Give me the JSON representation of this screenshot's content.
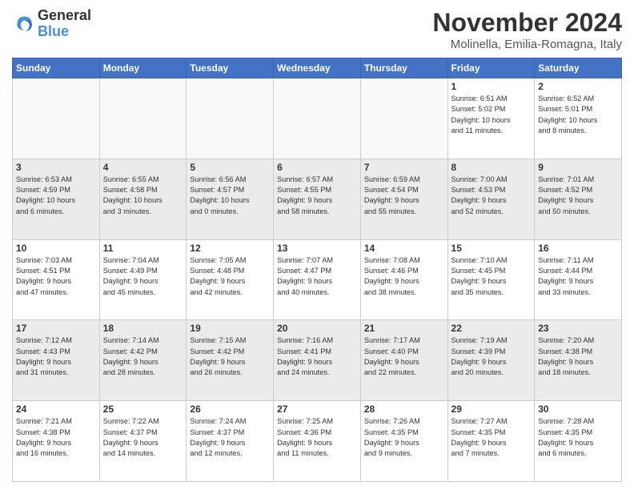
{
  "logo": {
    "line1": "General",
    "line2": "Blue"
  },
  "title": "November 2024",
  "location": "Molinella, Emilia-Romagna, Italy",
  "days_of_week": [
    "Sunday",
    "Monday",
    "Tuesday",
    "Wednesday",
    "Thursday",
    "Friday",
    "Saturday"
  ],
  "weeks": [
    [
      {
        "day": "",
        "info": "",
        "empty": true
      },
      {
        "day": "",
        "info": "",
        "empty": true
      },
      {
        "day": "",
        "info": "",
        "empty": true
      },
      {
        "day": "",
        "info": "",
        "empty": true
      },
      {
        "day": "",
        "info": "",
        "empty": true
      },
      {
        "day": "1",
        "info": "Sunrise: 6:51 AM\nSunset: 5:02 PM\nDaylight: 10 hours\nand 11 minutes."
      },
      {
        "day": "2",
        "info": "Sunrise: 6:52 AM\nSunset: 5:01 PM\nDaylight: 10 hours\nand 8 minutes."
      }
    ],
    [
      {
        "day": "3",
        "info": "Sunrise: 6:53 AM\nSunset: 4:59 PM\nDaylight: 10 hours\nand 6 minutes."
      },
      {
        "day": "4",
        "info": "Sunrise: 6:55 AM\nSunset: 4:58 PM\nDaylight: 10 hours\nand 3 minutes."
      },
      {
        "day": "5",
        "info": "Sunrise: 6:56 AM\nSunset: 4:57 PM\nDaylight: 10 hours\nand 0 minutes."
      },
      {
        "day": "6",
        "info": "Sunrise: 6:57 AM\nSunset: 4:55 PM\nDaylight: 9 hours\nand 58 minutes."
      },
      {
        "day": "7",
        "info": "Sunrise: 6:59 AM\nSunset: 4:54 PM\nDaylight: 9 hours\nand 55 minutes."
      },
      {
        "day": "8",
        "info": "Sunrise: 7:00 AM\nSunset: 4:53 PM\nDaylight: 9 hours\nand 52 minutes."
      },
      {
        "day": "9",
        "info": "Sunrise: 7:01 AM\nSunset: 4:52 PM\nDaylight: 9 hours\nand 50 minutes."
      }
    ],
    [
      {
        "day": "10",
        "info": "Sunrise: 7:03 AM\nSunset: 4:51 PM\nDaylight: 9 hours\nand 47 minutes."
      },
      {
        "day": "11",
        "info": "Sunrise: 7:04 AM\nSunset: 4:49 PM\nDaylight: 9 hours\nand 45 minutes."
      },
      {
        "day": "12",
        "info": "Sunrise: 7:05 AM\nSunset: 4:48 PM\nDaylight: 9 hours\nand 42 minutes."
      },
      {
        "day": "13",
        "info": "Sunrise: 7:07 AM\nSunset: 4:47 PM\nDaylight: 9 hours\nand 40 minutes."
      },
      {
        "day": "14",
        "info": "Sunrise: 7:08 AM\nSunset: 4:46 PM\nDaylight: 9 hours\nand 38 minutes."
      },
      {
        "day": "15",
        "info": "Sunrise: 7:10 AM\nSunset: 4:45 PM\nDaylight: 9 hours\nand 35 minutes."
      },
      {
        "day": "16",
        "info": "Sunrise: 7:11 AM\nSunset: 4:44 PM\nDaylight: 9 hours\nand 33 minutes."
      }
    ],
    [
      {
        "day": "17",
        "info": "Sunrise: 7:12 AM\nSunset: 4:43 PM\nDaylight: 9 hours\nand 31 minutes."
      },
      {
        "day": "18",
        "info": "Sunrise: 7:14 AM\nSunset: 4:42 PM\nDaylight: 9 hours\nand 28 minutes."
      },
      {
        "day": "19",
        "info": "Sunrise: 7:15 AM\nSunset: 4:42 PM\nDaylight: 9 hours\nand 26 minutes."
      },
      {
        "day": "20",
        "info": "Sunrise: 7:16 AM\nSunset: 4:41 PM\nDaylight: 9 hours\nand 24 minutes."
      },
      {
        "day": "21",
        "info": "Sunrise: 7:17 AM\nSunset: 4:40 PM\nDaylight: 9 hours\nand 22 minutes."
      },
      {
        "day": "22",
        "info": "Sunrise: 7:19 AM\nSunset: 4:39 PM\nDaylight: 9 hours\nand 20 minutes."
      },
      {
        "day": "23",
        "info": "Sunrise: 7:20 AM\nSunset: 4:38 PM\nDaylight: 9 hours\nand 18 minutes."
      }
    ],
    [
      {
        "day": "24",
        "info": "Sunrise: 7:21 AM\nSunset: 4:38 PM\nDaylight: 9 hours\nand 16 minutes."
      },
      {
        "day": "25",
        "info": "Sunrise: 7:22 AM\nSunset: 4:37 PM\nDaylight: 9 hours\nand 14 minutes."
      },
      {
        "day": "26",
        "info": "Sunrise: 7:24 AM\nSunset: 4:37 PM\nDaylight: 9 hours\nand 12 minutes."
      },
      {
        "day": "27",
        "info": "Sunrise: 7:25 AM\nSunset: 4:36 PM\nDaylight: 9 hours\nand 11 minutes."
      },
      {
        "day": "28",
        "info": "Sunrise: 7:26 AM\nSunset: 4:35 PM\nDaylight: 9 hours\nand 9 minutes."
      },
      {
        "day": "29",
        "info": "Sunrise: 7:27 AM\nSunset: 4:35 PM\nDaylight: 9 hours\nand 7 minutes."
      },
      {
        "day": "30",
        "info": "Sunrise: 7:28 AM\nSunset: 4:35 PM\nDaylight: 9 hours\nand 6 minutes."
      }
    ]
  ]
}
